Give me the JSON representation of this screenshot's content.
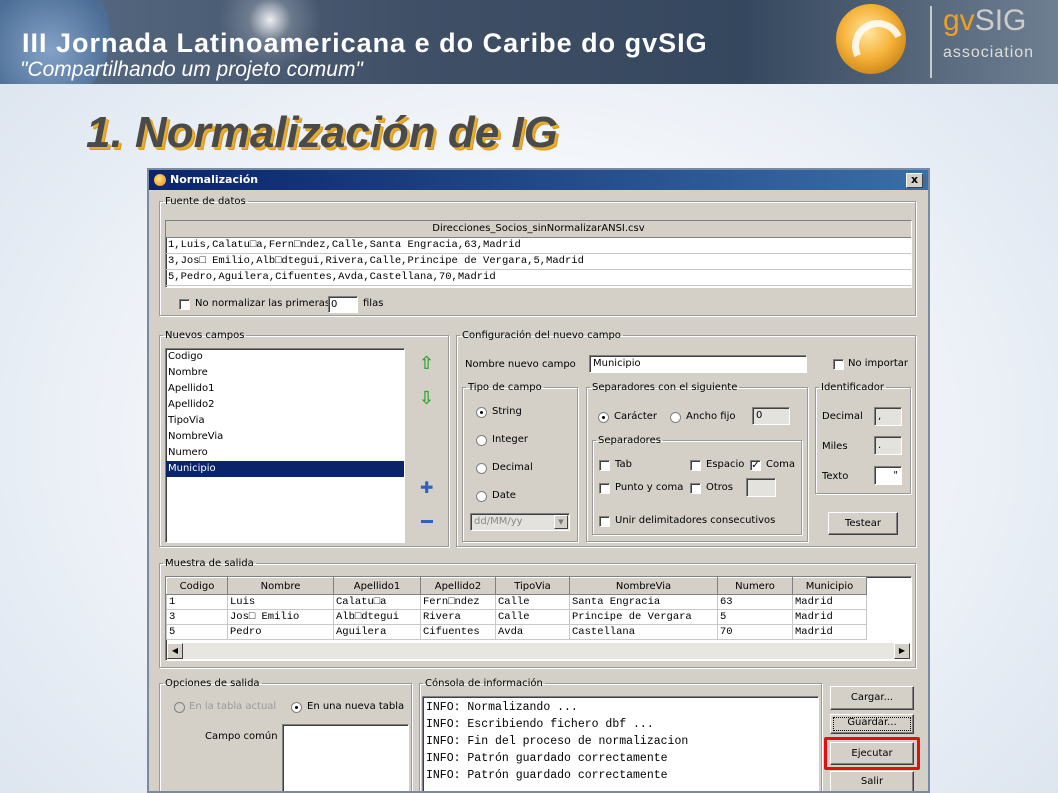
{
  "banner": {
    "title": "III Jornada Latinoamericana e do Caribe do gvSIG",
    "subtitle": "\"Compartilhando um projeto comum\"",
    "logo_gv": "gv",
    "logo_sig": "SIG",
    "logo_assoc": "association"
  },
  "slide": {
    "title": "1. Normalización de IG"
  },
  "window": {
    "title": "Normalización",
    "close": "x",
    "source": {
      "legend": "Fuente de datos",
      "file": "Direcciones_Socios_sinNormalizarANSI.csv",
      "lines": [
        "1,Luis,Calatu□a,Fern□ndez,Calle,Santa Engracia,63,Madrid",
        "3,Jos□ Emilio,Alb□dtegui,Rivera,Calle,Principe de Vergara,5,Madrid",
        "5,Pedro,Aguilera,Cifuentes,Avda,Castellana,70,Madrid"
      ],
      "skip_label": "No normalizar las primeras",
      "skip_value": "0",
      "skip_suffix": "filas"
    },
    "fields": {
      "legend": "Nuevos campos",
      "items": [
        "Codigo",
        "Nombre",
        "Apellido1",
        "Apellido2",
        "TipoVia",
        "NombreVia",
        "Numero",
        "Municipio"
      ],
      "selected": "Municipio"
    },
    "config": {
      "legend": "Configuración del nuevo campo",
      "name_label": "Nombre nuevo campo",
      "name_value": "Municipio",
      "no_importar": "No importar",
      "tipo": {
        "legend": "Tipo de campo",
        "options": [
          "String",
          "Integer",
          "Decimal",
          "Date"
        ],
        "selected": "String",
        "date_format": "dd/MM/yy"
      },
      "separadores_siguiente": {
        "legend": "Separadores con el siguiente",
        "caracter": "Carácter",
        "ancho_fijo": "Ancho fijo",
        "ancho_value": "0"
      },
      "separadores": {
        "legend": "Separadores",
        "tab": "Tab",
        "espacio": "Espacio",
        "coma": "Coma",
        "punto_y_coma": "Punto y coma",
        "otros": "Otros",
        "unir": "Unir delimitadores consecutivos"
      },
      "identificador": {
        "legend": "Identificador",
        "decimal_label": "Decimal",
        "decimal_value": ",",
        "miles_label": "Miles",
        "miles_value": ".",
        "texto_label": "Texto",
        "texto_value": "\""
      },
      "testear": "Testear"
    },
    "muestra": {
      "legend": "Muestra de salida",
      "columns": [
        "Codigo",
        "Nombre",
        "Apellido1",
        "Apellido2",
        "TipoVia",
        "NombreVia",
        "Numero",
        "Municipio"
      ],
      "rows": [
        [
          "1",
          "Luis",
          "Calatu□a",
          "Fern□ndez",
          "Calle",
          "Santa Engracia",
          "63",
          "Madrid"
        ],
        [
          "3",
          "Jos□ Emilio",
          "Alb□dtegui",
          "Rivera",
          "Calle",
          "Principe de Vergara",
          "5",
          "Madrid"
        ],
        [
          "5",
          "Pedro",
          "Aguilera",
          "Cifuentes",
          "Avda",
          "Castellana",
          "70",
          "Madrid"
        ]
      ]
    },
    "opciones": {
      "legend": "Opciones de salida",
      "en_tabla_actual": "En la tabla actual",
      "en_nueva_tabla": "En una nueva tabla",
      "campo_comun": "Campo común"
    },
    "consola": {
      "legend": "Cónsola de información",
      "lines": [
        "INFO: Normalizando ...",
        "INFO: Escribiendo fichero dbf ...",
        "INFO: Fin del proceso de normalizacion",
        "INFO: Patrón guardado correctamente",
        "INFO: Patrón guardado correctamente"
      ]
    },
    "buttons": {
      "cargar": "Cargar...",
      "guardar": "Guardar...",
      "ejecutar": "Ejecutar",
      "salir": "Salir"
    }
  },
  "colors": {
    "title_bar": "#0a246a",
    "selection": "#0a246a",
    "highlight_box": "#e01010",
    "arrow_green": "#3aa43a",
    "plus_blue": "#3060c0"
  }
}
